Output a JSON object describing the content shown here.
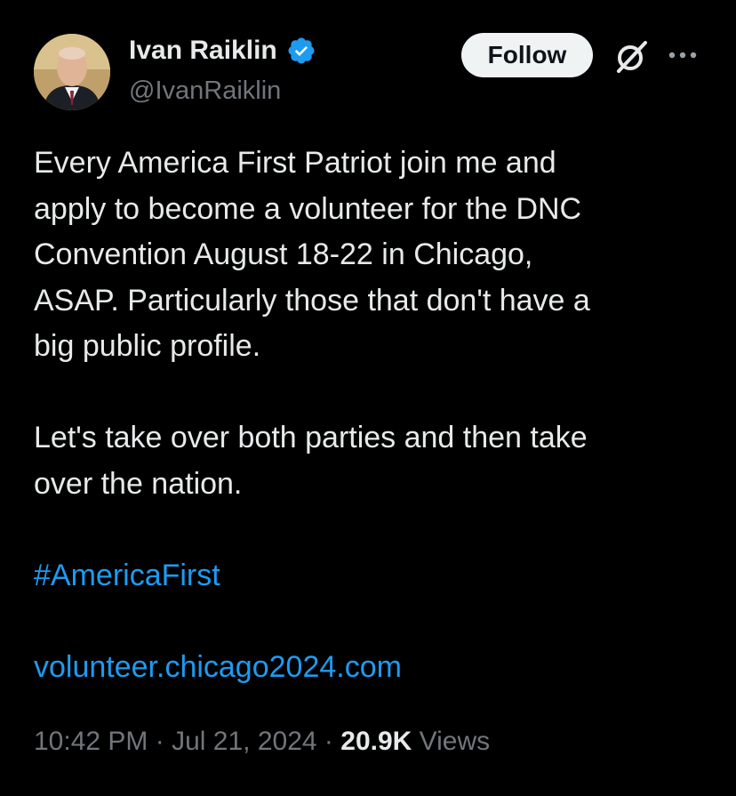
{
  "author": {
    "name": "Ivan Raiklin",
    "handle": "@IvanRaiklin",
    "verified": true,
    "avatar_icon": "profile-photo"
  },
  "header": {
    "follow_label": "Follow",
    "grok_icon": "grok-icon",
    "more_icon": "more-icon"
  },
  "tweet": {
    "lines_p1": [
      "Every America First Patriot join me and",
      "apply to become a volunteer for the DNC",
      "Convention August 18-22 in Chicago,",
      "ASAP.  Particularly those that don't have a",
      "big public profile."
    ],
    "lines_p2": [
      "Let's take over both parties and then take",
      "over the nation."
    ],
    "hashtag": "#AmericaFirst",
    "link": "volunteer.chicago2024.com"
  },
  "meta": {
    "time": "10:42 PM",
    "sep1": "·",
    "date": "Jul 21, 2024",
    "sep2": "·",
    "views_count": "20.9K",
    "views_label": "Views"
  },
  "colors": {
    "background": "#000000",
    "text": "#e7e9ea",
    "muted": "#71767b",
    "link": "#1d9bf0",
    "verified": "#1d9bf0"
  }
}
